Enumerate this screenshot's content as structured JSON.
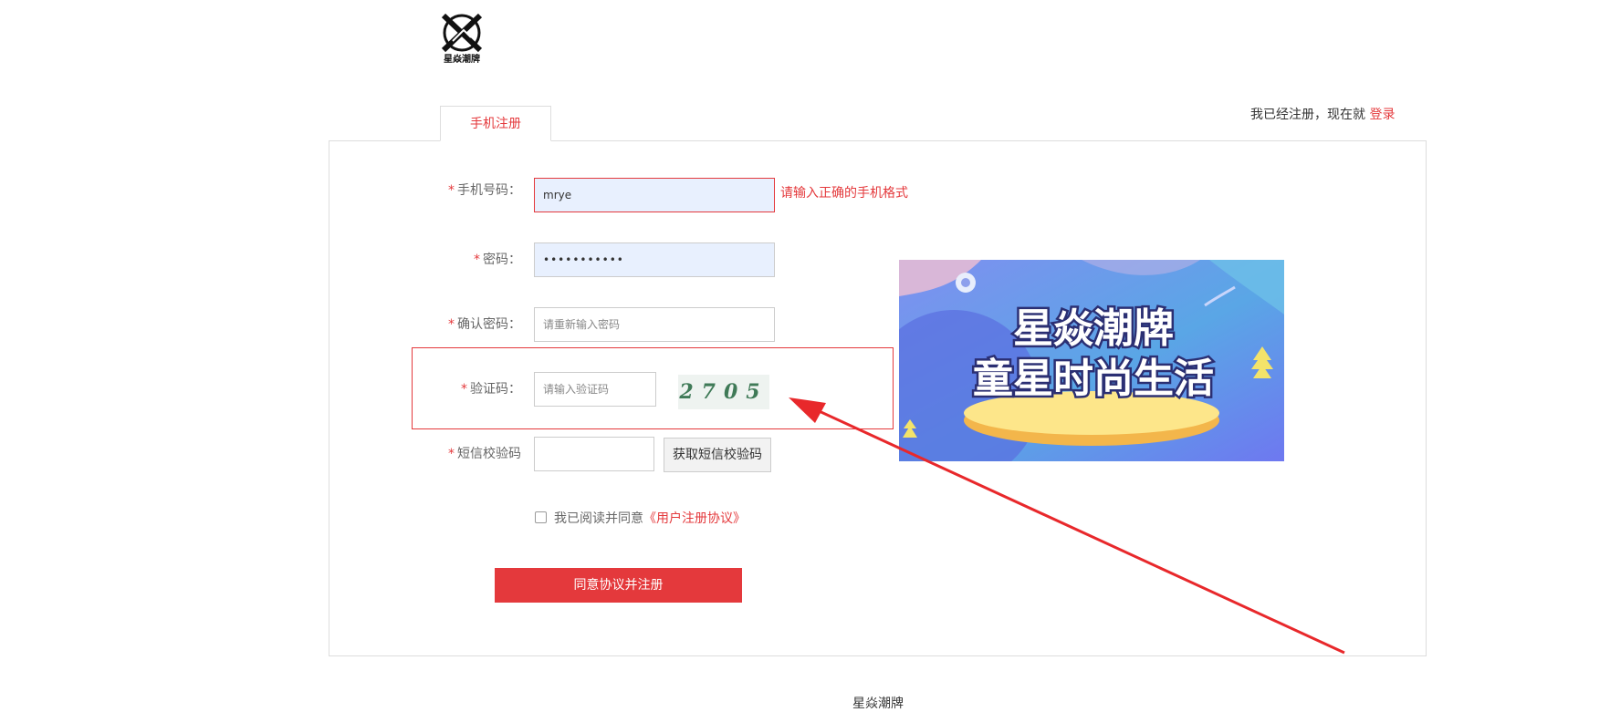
{
  "header": {
    "logo_text": "星焱潮牌"
  },
  "tabs": [
    {
      "label": "手机注册"
    }
  ],
  "login_hint": {
    "text": "我已经注册，现在就",
    "link": "登录"
  },
  "form": {
    "required_mark": "*",
    "phone": {
      "label": "手机号码：",
      "value": "mrye",
      "error": "请输入正确的手机格式"
    },
    "password": {
      "label": "密码：",
      "value": "•••••••••••"
    },
    "confirm_password": {
      "label": "确认密码：",
      "placeholder": "请重新输入密码"
    },
    "captcha": {
      "label": "验证码：",
      "placeholder": "请输入验证码",
      "image_text": "2705"
    },
    "sms": {
      "label": "短信校验码",
      "button": "获取短信校验码"
    },
    "agreement": {
      "text": "我已阅读并同意",
      "link": "《用户注册协议》"
    },
    "submit": "同意协议并注册"
  },
  "banner": {
    "line1": "星焱潮牌",
    "line2": "童星时尚生活"
  },
  "footer": {
    "brand": "星焱潮牌"
  },
  "colors": {
    "accent": "#e4393c",
    "annotation": "#e8282b"
  }
}
